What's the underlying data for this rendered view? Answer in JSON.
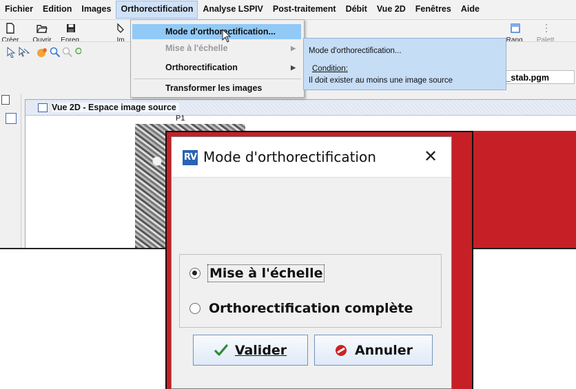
{
  "menubar": {
    "items": [
      "Fichier",
      "Edition",
      "Images",
      "Orthorectification",
      "Analyse LSPIV",
      "Post-traitement",
      "Débit",
      "Vue 2D",
      "Fenêtres",
      "Aide"
    ]
  },
  "toolbar": {
    "creer": "Créer",
    "ouvrir": "Ouvrir",
    "enreg": "Enreg.",
    "im": "Im",
    "rang": "Rang.",
    "palett": "Palett.",
    "current_file": "l_stab.pgm"
  },
  "dropdown": {
    "items": [
      {
        "label": "Mode d'orthorectification...",
        "state": "highlighted"
      },
      {
        "label": "Mise à l'échelle",
        "state": "disabled",
        "submenu": true
      },
      {
        "label": "Orthorectification",
        "state": "enabled",
        "submenu": true
      },
      {
        "label": "Transformer les images",
        "state": "enabled"
      }
    ]
  },
  "tooltip": {
    "title": "Mode d'orthorectification...",
    "condition_label": "Condition:",
    "condition_text": "Il doit exister au moins une image source"
  },
  "inner_window": {
    "title": "Vue 2D - Espace image source",
    "point_label": "P1"
  },
  "dialog": {
    "title": "Mode d'orthorectification",
    "logo_text": "RV",
    "options": [
      {
        "label": "Mise à l'échelle",
        "selected": true
      },
      {
        "label": "Orthorectification complète",
        "selected": false
      }
    ],
    "validate_label": "Valider",
    "cancel_label": "Annuler"
  },
  "colors": {
    "dialog_background_red": "#c62026",
    "menu_highlight": "#91c9f7",
    "tooltip_bg": "#c6ddf6",
    "logo_blue": "#2a63b5"
  }
}
